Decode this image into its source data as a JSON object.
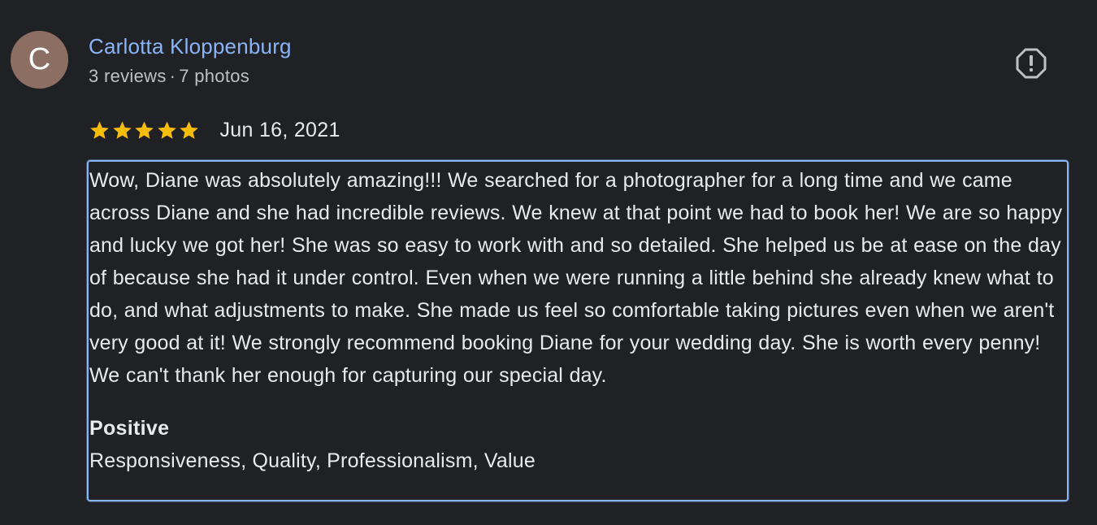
{
  "author": {
    "initial": "C",
    "avatar_color": "#8d6e63",
    "name": "Carlotta Kloppenburg",
    "reviews": "3 reviews",
    "separator": "·",
    "photos": "7 photos"
  },
  "report": {
    "icon": "report-icon"
  },
  "rating": {
    "stars": 5,
    "max_stars": 5,
    "star_color": "#fbbc04",
    "date": "Jun 16, 2021"
  },
  "review": {
    "text": "Wow, Diane was absolutely amazing!!! We searched for a photographer for a long time and we came across Diane and she had incredible reviews. We knew at that point we had to book her! We are so happy and lucky we got her! She was so easy to work with and so detailed. She helped us be at ease on the day of because she had it under control. Even when we were running a little behind she already knew what to do, and what adjustments to make. She made us feel so comfortable taking pictures even when we aren't very good at it! We strongly recommend booking Diane for your wedding day. She is worth every penny! We can't thank her enough for capturing our special day.",
    "attribute_heading": "Positive",
    "attribute_values": "Responsiveness, Quality, Professionalism, Value"
  },
  "colors": {
    "background": "#202124",
    "link": "#8ab4f8",
    "text": "#e8eaed",
    "secondary_text": "#bdc1c6"
  }
}
